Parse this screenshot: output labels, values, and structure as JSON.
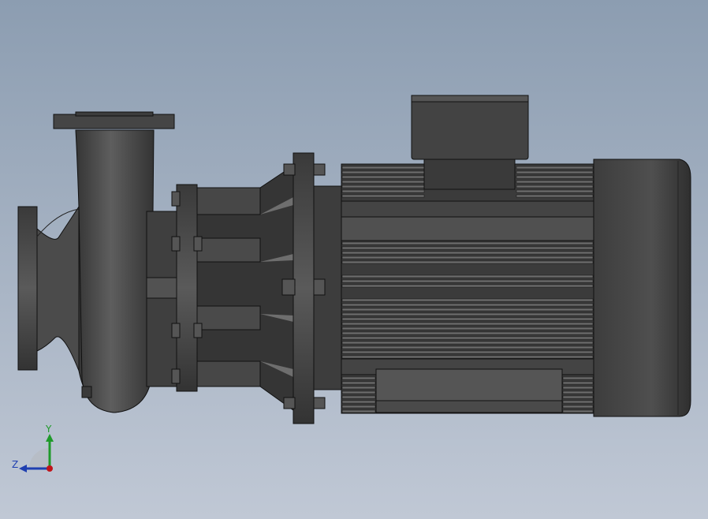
{
  "viewport": {
    "background_top": "#8c9db1",
    "background_bottom": "#c0c8d5"
  },
  "model": {
    "part_color": "#4a4a4a",
    "edge_color": "#111111",
    "highlight_color": "#6b6b6b"
  },
  "triad": {
    "y_label": "Y",
    "z_label": "Z",
    "y_color": "#1f9a2a",
    "z_color": "#1f3fb0",
    "x_color": "#c0141a"
  }
}
